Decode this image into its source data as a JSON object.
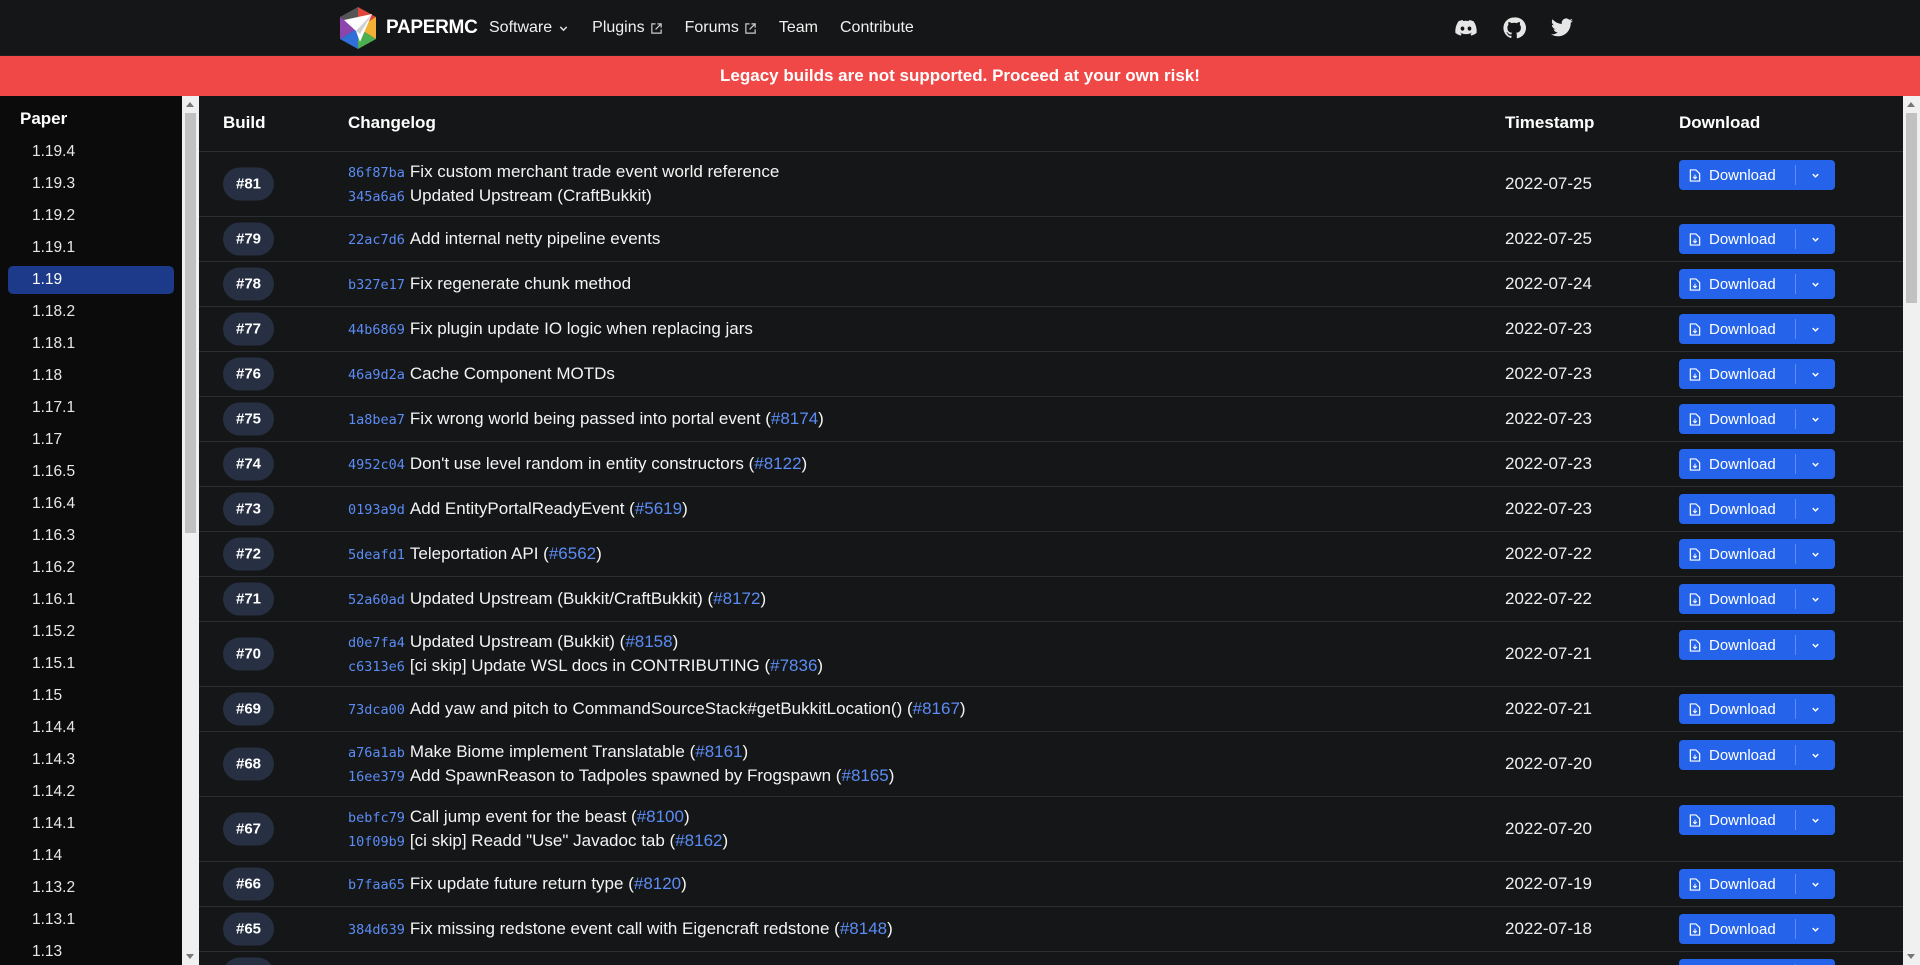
{
  "nav": {
    "brand": "PAPERMC",
    "links": [
      {
        "label": "Software",
        "icon": "chevron-down-icon"
      },
      {
        "label": "Plugins",
        "icon": "external-link-icon"
      },
      {
        "label": "Forums",
        "icon": "external-link-icon"
      },
      {
        "label": "Team",
        "icon": ""
      },
      {
        "label": "Contribute",
        "icon": ""
      }
    ],
    "social": [
      "discord-icon",
      "github-icon",
      "twitter-icon"
    ]
  },
  "warning": "Legacy builds are not supported. Proceed at your own risk!",
  "sidebar": {
    "title": "Paper",
    "versions": [
      "1.19.4",
      "1.19.3",
      "1.19.2",
      "1.19.1",
      "1.19",
      "1.18.2",
      "1.18.1",
      "1.18",
      "1.17.1",
      "1.17",
      "1.16.5",
      "1.16.4",
      "1.16.3",
      "1.16.2",
      "1.16.1",
      "1.15.2",
      "1.15.1",
      "1.15",
      "1.14.4",
      "1.14.3",
      "1.14.2",
      "1.14.1",
      "1.14",
      "1.13.2",
      "1.13.1",
      "1.13"
    ],
    "active": "1.19"
  },
  "table": {
    "headers": {
      "build": "Build",
      "changelog": "Changelog",
      "timestamp": "Timestamp",
      "download": "Download"
    },
    "download_label": "Download",
    "rows": [
      {
        "build": "#81",
        "timestamp": "2022-07-25",
        "changes": [
          {
            "commit": "86f87ba",
            "message": "Fix custom merchant trade event world reference",
            "pr": ""
          },
          {
            "commit": "345a6a6",
            "message": "Updated Upstream (CraftBukkit)",
            "pr": ""
          }
        ]
      },
      {
        "build": "#79",
        "timestamp": "2022-07-25",
        "changes": [
          {
            "commit": "22ac7d6",
            "message": "Add internal netty pipeline events",
            "pr": ""
          }
        ]
      },
      {
        "build": "#78",
        "timestamp": "2022-07-24",
        "changes": [
          {
            "commit": "b327e17",
            "message": "Fix regenerate chunk method",
            "pr": ""
          }
        ]
      },
      {
        "build": "#77",
        "timestamp": "2022-07-23",
        "changes": [
          {
            "commit": "44b6869",
            "message": "Fix plugin update IO logic when replacing jars",
            "pr": ""
          }
        ]
      },
      {
        "build": "#76",
        "timestamp": "2022-07-23",
        "changes": [
          {
            "commit": "46a9d2a",
            "message": "Cache Component MOTDs",
            "pr": ""
          }
        ]
      },
      {
        "build": "#75",
        "timestamp": "2022-07-23",
        "changes": [
          {
            "commit": "1a8bea7",
            "message": "Fix wrong world being passed into portal event (",
            "pr": "#8174"
          }
        ]
      },
      {
        "build": "#74",
        "timestamp": "2022-07-23",
        "changes": [
          {
            "commit": "4952c04",
            "message": "Don't use level random in entity constructors (",
            "pr": "#8122"
          }
        ]
      },
      {
        "build": "#73",
        "timestamp": "2022-07-23",
        "changes": [
          {
            "commit": "0193a9d",
            "message": "Add EntityPortalReadyEvent (",
            "pr": "#5619"
          }
        ]
      },
      {
        "build": "#72",
        "timestamp": "2022-07-22",
        "changes": [
          {
            "commit": "5deafd1",
            "message": "Teleportation API (",
            "pr": "#6562"
          }
        ]
      },
      {
        "build": "#71",
        "timestamp": "2022-07-22",
        "changes": [
          {
            "commit": "52a60ad",
            "message": "Updated Upstream (Bukkit/CraftBukkit) (",
            "pr": "#8172"
          }
        ]
      },
      {
        "build": "#70",
        "timestamp": "2022-07-21",
        "changes": [
          {
            "commit": "d0e7fa4",
            "message": "Updated Upstream (Bukkit) (",
            "pr": "#8158"
          },
          {
            "commit": "c6313e6",
            "message": "[ci skip] Update WSL docs in CONTRIBUTING (",
            "pr": "#7836"
          }
        ]
      },
      {
        "build": "#69",
        "timestamp": "2022-07-21",
        "changes": [
          {
            "commit": "73dca00",
            "message": "Add yaw and pitch to CommandSourceStack#getBukkitLocation() (",
            "pr": "#8167"
          }
        ]
      },
      {
        "build": "#68",
        "timestamp": "2022-07-20",
        "changes": [
          {
            "commit": "a76a1ab",
            "message": "Make Biome implement Translatable (",
            "pr": "#8161"
          },
          {
            "commit": "16ee379",
            "message": "Add SpawnReason to Tadpoles spawned by Frogspawn (",
            "pr": "#8165"
          }
        ]
      },
      {
        "build": "#67",
        "timestamp": "2022-07-20",
        "changes": [
          {
            "commit": "bebfc79",
            "message": "Call jump event for the beast (",
            "pr": "#8100"
          },
          {
            "commit": "10f09b9",
            "message": "[ci skip] Readd \"Use\" Javadoc tab (",
            "pr": "#8162"
          }
        ]
      },
      {
        "build": "#66",
        "timestamp": "2022-07-19",
        "changes": [
          {
            "commit": "b7faa65",
            "message": "Fix update future return type (",
            "pr": "#8120"
          }
        ]
      },
      {
        "build": "#65",
        "timestamp": "2022-07-18",
        "changes": [
          {
            "commit": "384d639",
            "message": "Fix missing redstone event call with Eigencraft redstone (",
            "pr": "#8148"
          }
        ]
      },
      {
        "build": "#64",
        "timestamp": "",
        "changes": [
          {
            "commit": "",
            "message": "",
            "pr": ""
          }
        ]
      }
    ]
  },
  "colors": {
    "accent": "#2563eb",
    "warning": "#f04747",
    "link": "#5b8cf5",
    "active_version": "#1d3a8a"
  }
}
